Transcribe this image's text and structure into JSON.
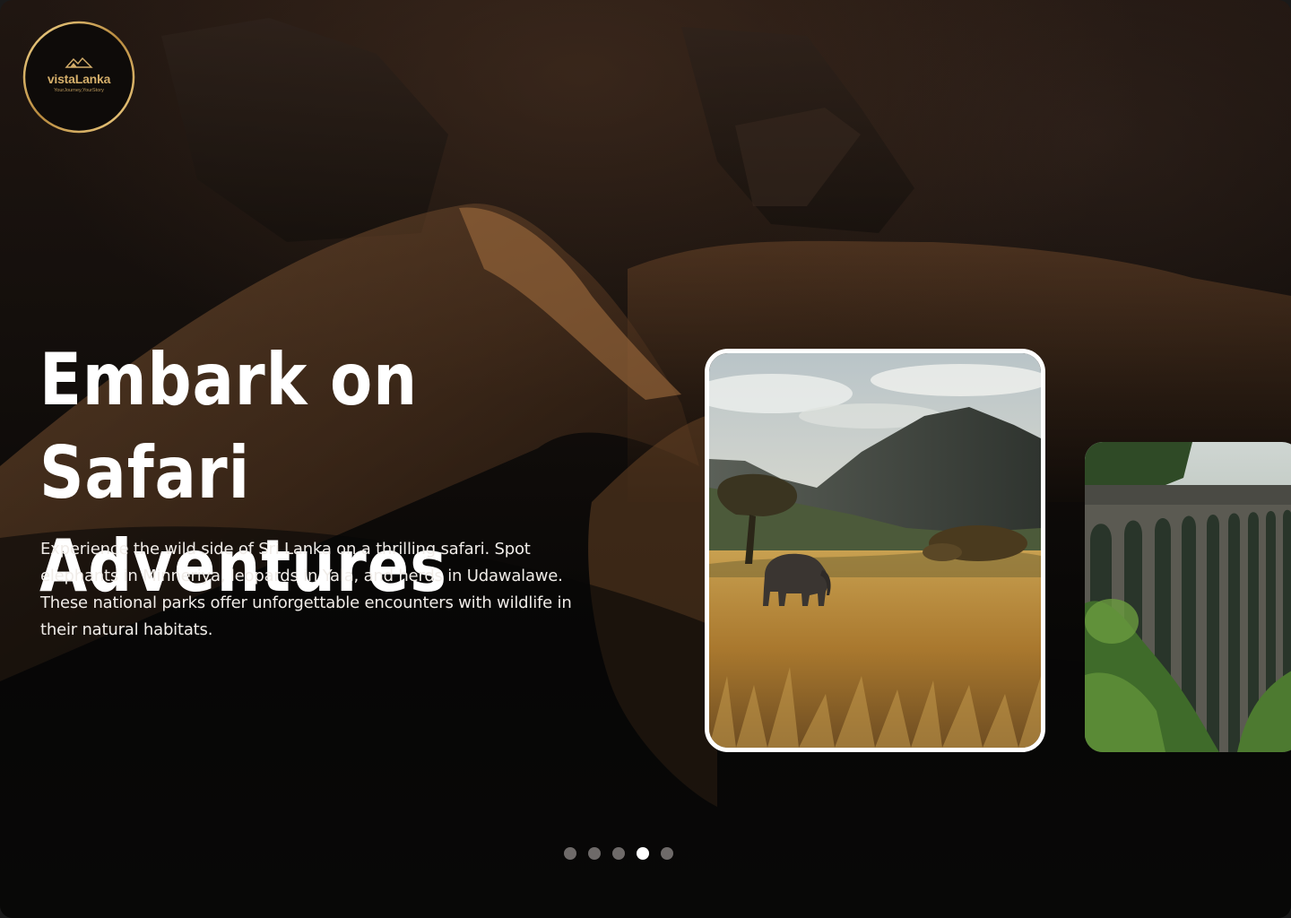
{
  "brand": {
    "name": "vistaLanka",
    "tagline": "YourJourney,YourStory",
    "accent_color": "#d4ae6a"
  },
  "hero": {
    "headline_line1": "Embark on Safari",
    "headline_line2": "Adventures",
    "description": "Experience the wild side of Sri Lanka on a thrilling safari. Spot elephants in Minneriya, leopards in Yala, and herds in Udawalawe. These national parks offer unforgettable encounters with wildlife in their natural habitats."
  },
  "carousel": {
    "cards": [
      {
        "name": "safari-card",
        "image": "elephant-savanna-image",
        "state": "active"
      },
      {
        "name": "nine-arch-bridge-card",
        "image": "arched-bridge-image",
        "state": "next"
      }
    ],
    "dots_count": 5,
    "active_index": 4
  },
  "colors": {
    "background": "#0b0a09",
    "text": "#ffffff",
    "dot_inactive": "#6e6a69",
    "dot_active": "#ffffff"
  }
}
